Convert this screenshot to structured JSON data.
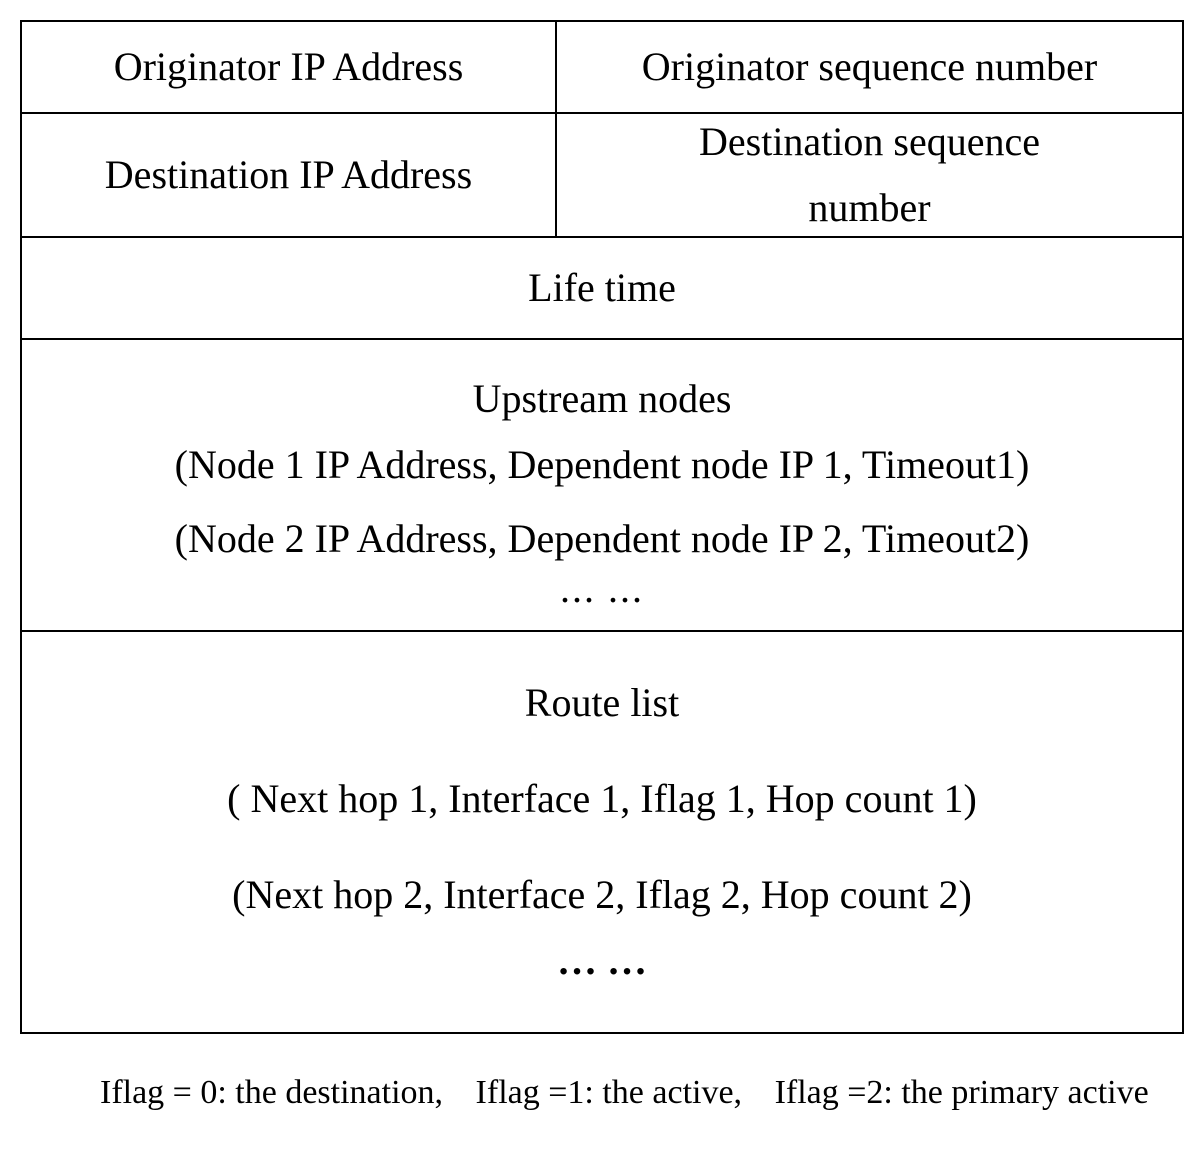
{
  "row1": {
    "left": "Originator IP Address",
    "right": "Originator sequence number"
  },
  "row2": {
    "left": "Destination IP Address",
    "right_l1": "Destination sequence",
    "right_l2": "number"
  },
  "row3": {
    "full": "Life time"
  },
  "row4": {
    "title": "Upstream nodes",
    "line1": "(Node 1 IP Address, Dependent node IP 1, Timeout1)",
    "line2": "(Node 2 IP Address, Dependent node IP 2, Timeout2)",
    "ellipsis": "...   ..."
  },
  "row5": {
    "title": "Route list",
    "line1": "( Next hop 1, Interface 1, Iflag 1, Hop count 1)",
    "line2": "(Next hop 2, Interface 2, Iflag 2,  Hop count 2)",
    "ellipsis": "… …"
  },
  "legend": {
    "a": "Iflag = 0: the destination,",
    "b": "Iflag =1: the active,",
    "c": "Iflag =2: the primary active"
  }
}
